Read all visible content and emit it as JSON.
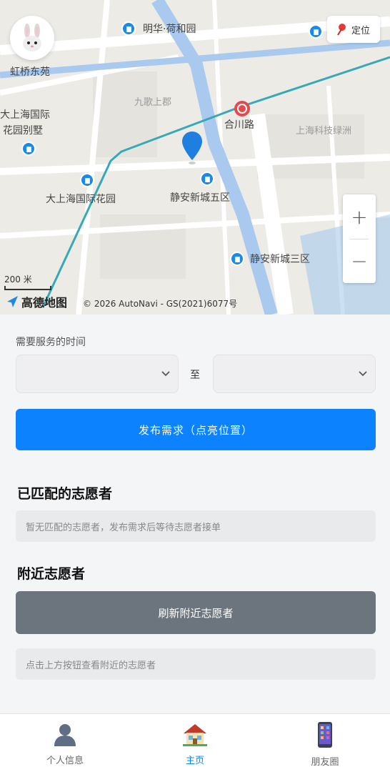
{
  "map": {
    "labels": {
      "mingle": "明华·荷和园",
      "hongqiao": "虹桥东苑",
      "dashanghai_intl": "大上海国际",
      "garden_villa": "花园别墅",
      "jiuge": "九歌上郡",
      "hechuan_road": "合川路",
      "tech_park": "上海科技绿洲",
      "dashanghai_garden": "大上海国际花园",
      "jingan_5": "静安新城五区",
      "jingan_3": "静安新城三区",
      "hechuan_road_v": "合川路",
      "small_left": "路"
    },
    "locate_label": "定位",
    "zoom_in": "+",
    "zoom_out": "−",
    "scale_text": "200 米",
    "brand": "高德地图",
    "copyright": "© 2026 AutoNavi - GS(2021)6077号",
    "colors": {
      "route": "#36a9b8",
      "water": "#a9c9ee",
      "metro": "#e5484d"
    }
  },
  "form": {
    "time_label": "需要服务的时间",
    "start_value": "",
    "end_value": "",
    "to_text": "至",
    "publish_button": "发布需求（点亮位置）"
  },
  "matched": {
    "title": "已匹配的志愿者",
    "empty_text": "暂无匹配的志愿者，发布需求后等待志愿者接单"
  },
  "nearby": {
    "title": "附近志愿者",
    "refresh_button": "刷新附近志愿者",
    "hint_text": "点击上方按钮查看附近的志愿者"
  },
  "tabs": [
    {
      "label": "个人信息",
      "icon": "person-icon"
    },
    {
      "label": "主页",
      "icon": "house-icon",
      "active": true
    },
    {
      "label": "朋友圈",
      "icon": "phone-icon"
    }
  ]
}
